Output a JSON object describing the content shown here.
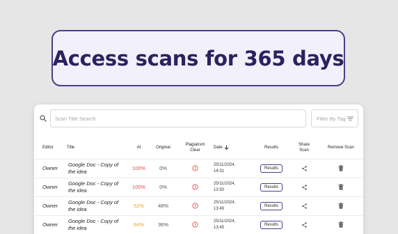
{
  "headline": "Access scans for 365 days",
  "search": {
    "placeholder": "Scan Title Search",
    "filter_label": "Filter By Tag"
  },
  "columns": {
    "editor": "Editor",
    "title": "Title",
    "ai": "AI",
    "original": "Original",
    "plagiarism_clear_1": "Plagiarism",
    "plagiarism_clear_2": "Clear",
    "date": "Date",
    "results": "Results",
    "share_1": "Share",
    "share_2": "Scan",
    "remove": "Remove Scan"
  },
  "results_button_label": "Results",
  "rows": [
    {
      "editor": "Owner",
      "title": "Google Doc - Copy of the idea",
      "ai": "100%",
      "ai_level": "high",
      "original": "0%",
      "date_line1": "25/11/2024,",
      "date_line2": "14:31"
    },
    {
      "editor": "Owner",
      "title": "Google Doc - Copy of the idea",
      "ai": "100%",
      "ai_level": "high",
      "original": "0%",
      "date_line1": "25/11/2024,",
      "date_line2": "13:50"
    },
    {
      "editor": "Owner",
      "title": "Google Doc - Copy of the idea",
      "ai": "52%",
      "ai_level": "medium",
      "original": "48%",
      "date_line1": "25/11/2024,",
      "date_line2": "13:49"
    },
    {
      "editor": "Owner",
      "title": "Google Doc - Copy of the idea",
      "ai": "64%",
      "ai_level": "medium",
      "original": "36%",
      "date_line1": "25/11/2024,",
      "date_line2": "13:45"
    }
  ],
  "colors": {
    "accent": "#4a3d86",
    "ai_high": "#e24b4b",
    "ai_medium": "#e9a23b",
    "clear_icon": "#e24b4b"
  },
  "icons": {
    "search": "search-icon",
    "filter": "filter-icon",
    "plagiarism": "alert-circle-icon",
    "share": "share-icon",
    "remove": "trash-icon",
    "sort": "arrow-down-icon"
  }
}
